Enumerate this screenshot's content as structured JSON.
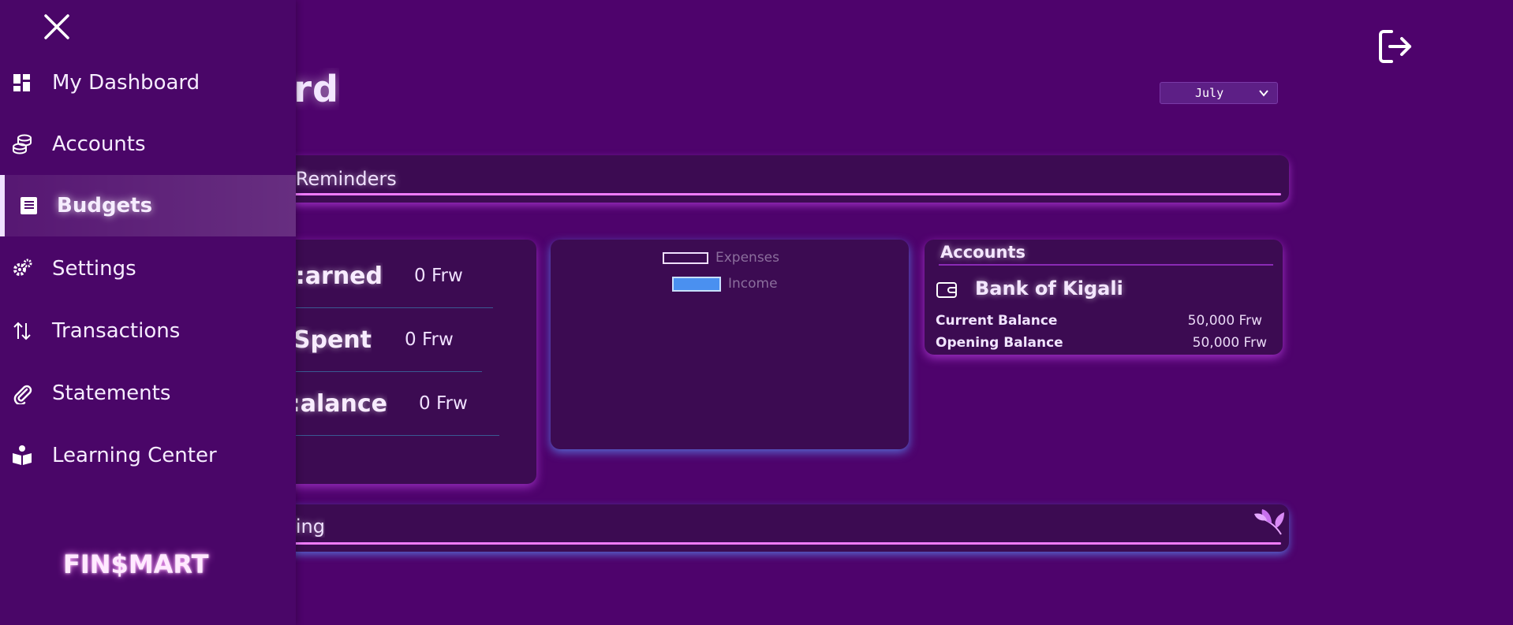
{
  "page": {
    "title": "rd",
    "month_select": {
      "value": "July"
    }
  },
  "reminders": {
    "label": "'s Reminders"
  },
  "summary": {
    "rows": [
      {
        "label": "arned:",
        "value": "0 Frw"
      },
      {
        "label": "Spent:",
        "value": "0 Frw"
      },
      {
        "label": "alance:",
        "value": "0 Frw"
      }
    ]
  },
  "chart": {
    "legend": [
      {
        "label": "Expenses",
        "color": "#ffffff",
        "fill": "#3c0b52"
      },
      {
        "label": "Income",
        "color": "#c8e0ff",
        "fill": "#4a90f0"
      }
    ]
  },
  "accounts": {
    "title": "Accounts",
    "bank_name": "Bank of Kigali",
    "current_balance_label": "Current Balance",
    "current_balance_value": "50,000 Frw",
    "opening_balance_label": "Opening Balance",
    "opening_balance_value": "50,000 Frw"
  },
  "spending": {
    "label": "ling:"
  },
  "sidebar": {
    "items": [
      {
        "label": "My Dashboard",
        "icon": "dashboard-icon"
      },
      {
        "label": "Accounts",
        "icon": "coins-icon"
      },
      {
        "label": "Budgets",
        "icon": "ledger-icon",
        "active": true
      },
      {
        "label": "Settings",
        "icon": "gears-icon"
      },
      {
        "label": "Transactions",
        "icon": "arrows-up-down-icon"
      },
      {
        "label": "Statements",
        "icon": "paperclip-icon"
      },
      {
        "label": "Learning Center",
        "icon": "book-reader-icon"
      }
    ],
    "brand": "FIN$MART"
  },
  "colors": {
    "background": "#4e036c",
    "sidebar": "#4a0668",
    "card": "#3c0b52",
    "accent_pink": "#f07bff",
    "accent_blue": "#5a96ff"
  }
}
